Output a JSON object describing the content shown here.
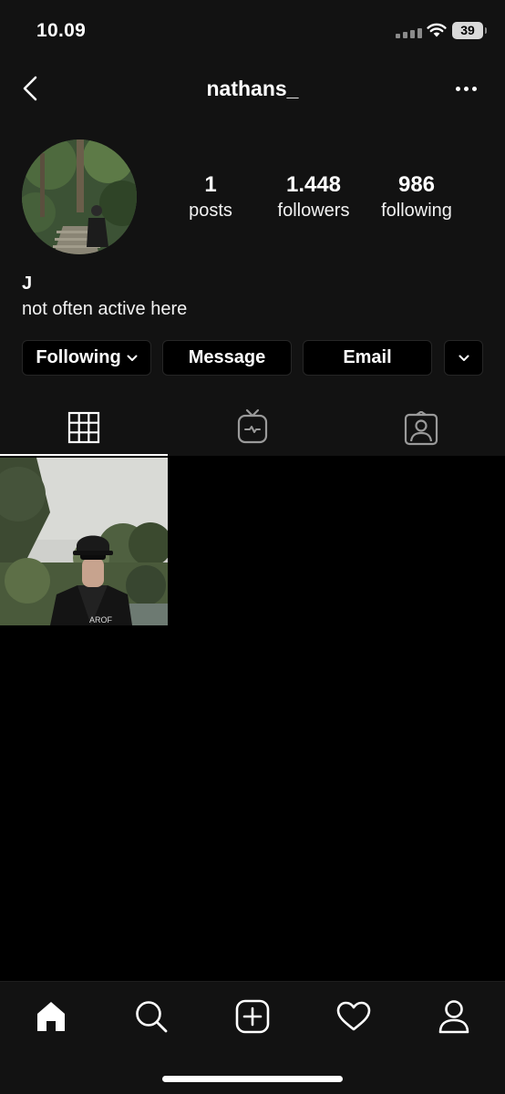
{
  "status_bar": {
    "time": "10.09",
    "battery": "39"
  },
  "header": {
    "username": "nathans_"
  },
  "profile": {
    "stats": [
      {
        "value": "1",
        "label": "posts"
      },
      {
        "value": "1.448",
        "label": "followers"
      },
      {
        "value": "986",
        "label": "following"
      }
    ],
    "bio_name": "J",
    "bio_text": "not often active here"
  },
  "actions": {
    "following_label": "Following",
    "message_label": "Message",
    "email_label": "Email"
  },
  "tabs": [
    {
      "icon": "grid-icon",
      "active": true
    },
    {
      "icon": "igtv-icon",
      "active": false
    },
    {
      "icon": "tagged-icon",
      "active": false
    }
  ],
  "nav": [
    "home-icon",
    "search-icon",
    "add-post-icon",
    "heart-icon",
    "profile-icon"
  ],
  "colors": {
    "background": "#121212",
    "feed_background": "#000000",
    "button_border": "#262626"
  }
}
